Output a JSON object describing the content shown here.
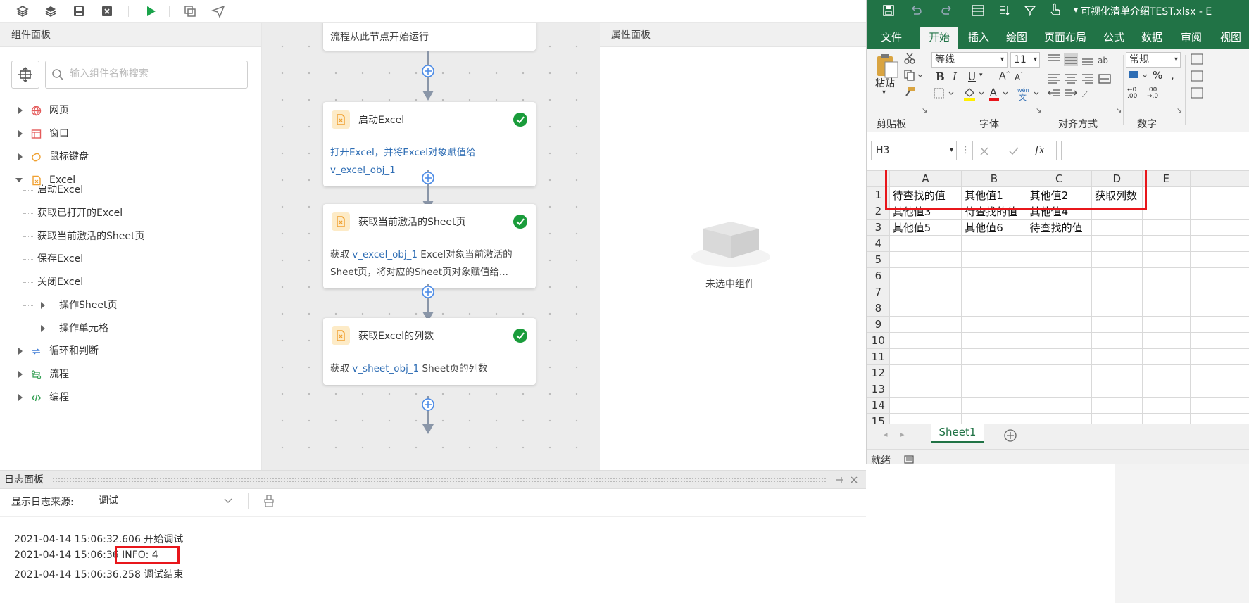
{
  "toolbar": {
    "buttons": [
      "layers-icon",
      "stack-icon",
      "save-icon",
      "close-doc-icon",
      "run-icon",
      "copy-icon",
      "send-icon"
    ]
  },
  "component_panel": {
    "title": "组件面板",
    "search_placeholder": "输入组件名称搜索",
    "tree": [
      {
        "label": "网页",
        "icon": "globe-icon",
        "color": "#e45a5a"
      },
      {
        "label": "窗口",
        "icon": "window-icon",
        "color": "#e45a5a"
      },
      {
        "label": "鼠标键盘",
        "icon": "mouse-keyboard-icon",
        "color": "#f0a030"
      },
      {
        "label": "Excel",
        "icon": "excel-icon",
        "color": "#f0a030",
        "expanded": true
      },
      {
        "label": "循环和判断",
        "icon": "loop-icon",
        "color": "#3e7bd6"
      },
      {
        "label": "流程",
        "icon": "flow-icon",
        "color": "#35a055"
      },
      {
        "label": "编程",
        "icon": "code-icon",
        "color": "#35a055"
      }
    ],
    "excel_children": [
      "启动Excel",
      "获取已打开的Excel",
      "获取当前激活的Sheet页",
      "保存Excel",
      "关闭Excel",
      "操作Sheet页",
      "操作单元格"
    ]
  },
  "canvas": {
    "start_node": "流程从此节点开始运行",
    "cards": [
      {
        "title": "启动Excel",
        "line1_prefix": "打开Excel，并将Excel对象赋值给",
        "line2_var": "v_excel_obj_1"
      },
      {
        "title": "获取当前激活的Sheet页",
        "line1_prefix": "获取 ",
        "line1_var": "v_excel_obj_1",
        "line1_suffix": " Excel对象当前激活的",
        "line2": "Sheet页，将对应的Sheet页对象赋值给..."
      },
      {
        "title": "获取Excel的列数",
        "line1_prefix": "获取 ",
        "line1_var": "v_sheet_obj_1",
        "line1_suffix": " Sheet页的列数"
      }
    ]
  },
  "property_panel": {
    "title": "属性面板",
    "empty_text": "未选中组件"
  },
  "log_panel": {
    "title": "日志面板",
    "source_label": "显示日志来源:",
    "source_value": "调试",
    "lines": [
      "2021-04-14 15:06:32.606 开始调试",
      "2021-04-14 15:06:36 INFO: 4",
      "2021-04-14 15:06:36.258 调试结束"
    ]
  },
  "excel": {
    "title": "可视化清单介绍TEST.xlsx - E",
    "tabs": [
      "文件",
      "开始",
      "插入",
      "绘图",
      "页面布局",
      "公式",
      "数据",
      "审阅",
      "视图"
    ],
    "active_tab": "开始",
    "font_name": "等线",
    "font_size": "11",
    "number_format": "常规",
    "paste_label": "粘贴",
    "groups": [
      "剪贴板",
      "字体",
      "对齐方式",
      "数字"
    ],
    "name_box": "H3",
    "fx_label": "fx",
    "columns": [
      "A",
      "B",
      "C",
      "D",
      "E"
    ],
    "rows": [
      [
        "1",
        "待查找的值",
        "其他值1",
        "其他值2",
        "获取列数",
        ""
      ],
      [
        "2",
        "其他值3",
        "待查找的值",
        "其他值4",
        "",
        ""
      ],
      [
        "3",
        "其他值5",
        "其他值6",
        "待查找的值",
        "",
        ""
      ],
      [
        "4",
        "",
        "",
        "",
        "",
        ""
      ],
      [
        "5",
        "",
        "",
        "",
        "",
        ""
      ],
      [
        "6",
        "",
        "",
        "",
        "",
        ""
      ],
      [
        "7",
        "",
        "",
        "",
        "",
        ""
      ],
      [
        "8",
        "",
        "",
        "",
        "",
        ""
      ],
      [
        "9",
        "",
        "",
        "",
        "",
        ""
      ],
      [
        "10",
        "",
        "",
        "",
        "",
        ""
      ],
      [
        "11",
        "",
        "",
        "",
        "",
        ""
      ],
      [
        "12",
        "",
        "",
        "",
        "",
        ""
      ],
      [
        "13",
        "",
        "",
        "",
        "",
        ""
      ],
      [
        "14",
        "",
        "",
        "",
        "",
        ""
      ],
      [
        "15",
        "",
        "",
        "",
        "",
        ""
      ]
    ],
    "sheet_tab": "Sheet1",
    "status": "就绪"
  },
  "colors": {
    "excel_green": "#217346",
    "highlight_red": "#e8161b",
    "link_blue": "#2e6db4"
  }
}
